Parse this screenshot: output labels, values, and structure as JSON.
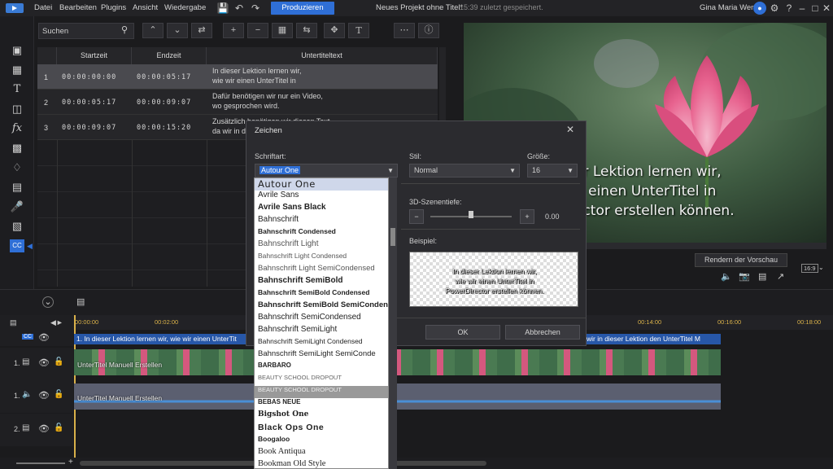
{
  "menubar": {
    "items": [
      "Datei",
      "Bearbeiten",
      "Plugins",
      "Ansicht",
      "Wiedergabe"
    ],
    "produce_label": "Produzieren",
    "project_title": "Neues Projekt ohne Titel*",
    "saved_time": "15:39 zuletzt gespeichert.",
    "user_name": "Gina Maria Wenz"
  },
  "subtitle_panel": {
    "search_placeholder": "Suchen",
    "columns": [
      "Startzeit",
      "Endzeit",
      "Untertiteltext"
    ],
    "rows": [
      {
        "num": "1",
        "start": "00:00:00:00",
        "end": "00:00:05:17",
        "line1": "In dieser Lektion lernen wir,",
        "line2": "wie wir einen UnterTitel in"
      },
      {
        "num": "2",
        "start": "00:00:05:17",
        "end": "00:00:09:07",
        "line1": "Dafür benötigen wir nur ein Video,",
        "line2": "wo gesprochen wird."
      },
      {
        "num": "3",
        "start": "00:00:09:07",
        "end": "00:00:15:20",
        "line1": "Zusätzlich benötigen wir diesen Text,",
        "line2": "da wir in d"
      }
    ]
  },
  "preview": {
    "line1": "er Lektion lernen wir,",
    "line2": "ir einen UnterTitel in",
    "line3": "ector erstellen können.",
    "render_label": "Rendern der Vorschau",
    "aspect": "16:9"
  },
  "dialog": {
    "title": "Zeichen",
    "font_label": "Schriftart:",
    "font_value": "Autour One",
    "style_label": "Stil:",
    "style_value": "Normal",
    "size_label": "Größe:",
    "size_value": "16",
    "depth_label": "3D-Szenentiefe:",
    "depth_value": "0.00",
    "example_label": "Beispiel:",
    "example_lines": [
      "In dieser Lektion lernen wir,",
      "wie wir einen UnterTitel in",
      "PowerDirector erstellen können."
    ],
    "ok_label": "OK",
    "cancel_label": "Abbrechen"
  },
  "font_list": [
    "Autour One",
    "Avrile Sans",
    "Avrile Sans Black",
    "Bahnschrift",
    "Bahnschrift Condensed",
    "Bahnschrift Light",
    "Bahnschrift Light Condensed",
    "Bahnschrift Light SemiCondensed",
    "Bahnschrift SemiBold",
    "Bahnschrift SemiBold Condensed",
    "Bahnschrift SemiBold SemiConden",
    "Bahnschrift SemiCondensed",
    "Bahnschrift SemiLight",
    "Bahnschrift SemiLight Condensed",
    "Bahnschrift SemiLight SemiConde",
    "BARBARO",
    "BEAUTY SCHOOL DROPOUT",
    "BEAUTY SCHOOL DROPOUT",
    "BEBAS NEUE",
    "Bigshot One",
    "Black Ops One",
    "Boogaloo",
    "Book Antiqua",
    "Bookman Old Style"
  ],
  "timeline": {
    "ruler": [
      "00:00:00",
      "00:02:00",
      "00:14:00",
      "00:16:00",
      "00:18:00"
    ],
    "cc_text": "1. In dieser Lektion lernen wir,  wie wir einen UnterTit",
    "cc_text2": "wir in dieser Lektion den UnterTitel  M",
    "tracks": [
      "1.",
      "1.",
      "2."
    ],
    "video_label": "UnterTitel Manuell Erstellen",
    "audio_label": "UnterTitel Manuell Erstellen"
  },
  "colors": {
    "accent": "#2f6fd6",
    "clip_blue": "#2757a8",
    "ruler_text": "#d9b14a"
  }
}
